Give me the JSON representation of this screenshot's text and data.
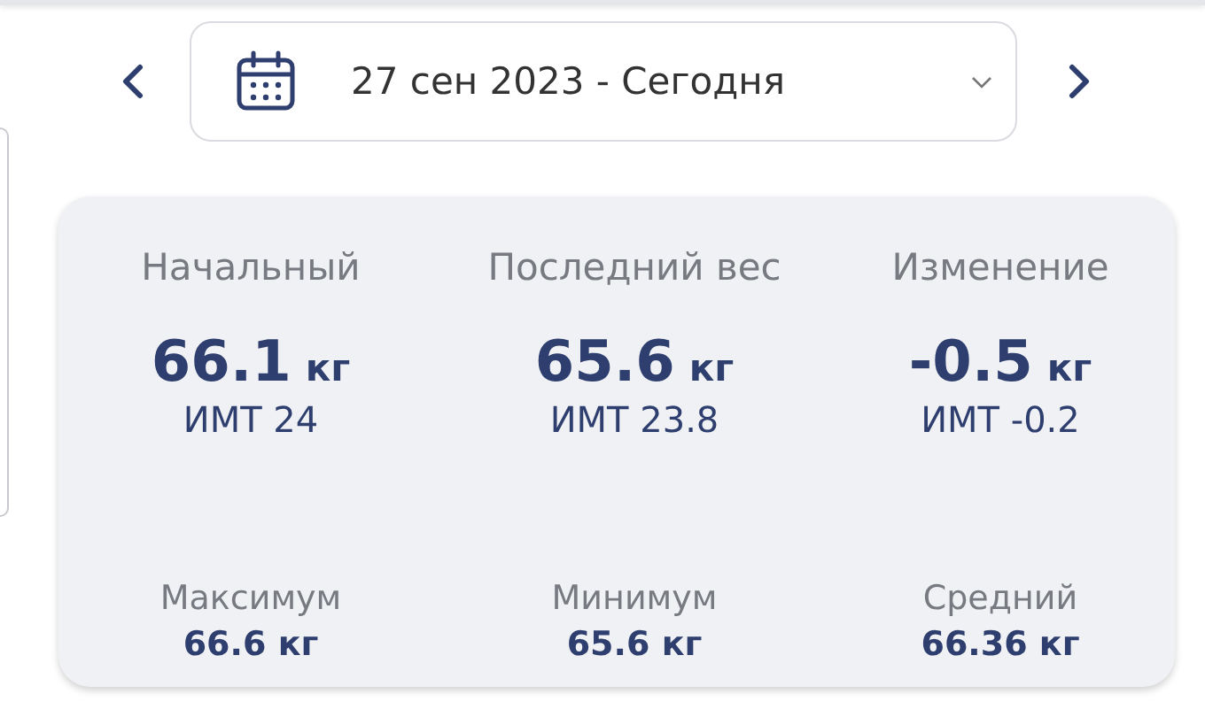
{
  "date_picker": {
    "label": "27 сен 2023 - Сегодня"
  },
  "summary": [
    {
      "label": "Начальный",
      "value": "66.1",
      "unit": "кг",
      "bmi": "ИМТ 24"
    },
    {
      "label": "Последний вес",
      "value": "65.6",
      "unit": "кг",
      "bmi": "ИМТ 23.8"
    },
    {
      "label": "Изменение",
      "value": "-0.5",
      "unit": "кг",
      "bmi": "ИМТ -0.2"
    }
  ],
  "details": [
    {
      "label": "Максимум",
      "value": "66.6 кг"
    },
    {
      "label": "Минимум",
      "value": "65.6 кг"
    },
    {
      "label": "Средний",
      "value": "66.36 кг"
    }
  ]
}
